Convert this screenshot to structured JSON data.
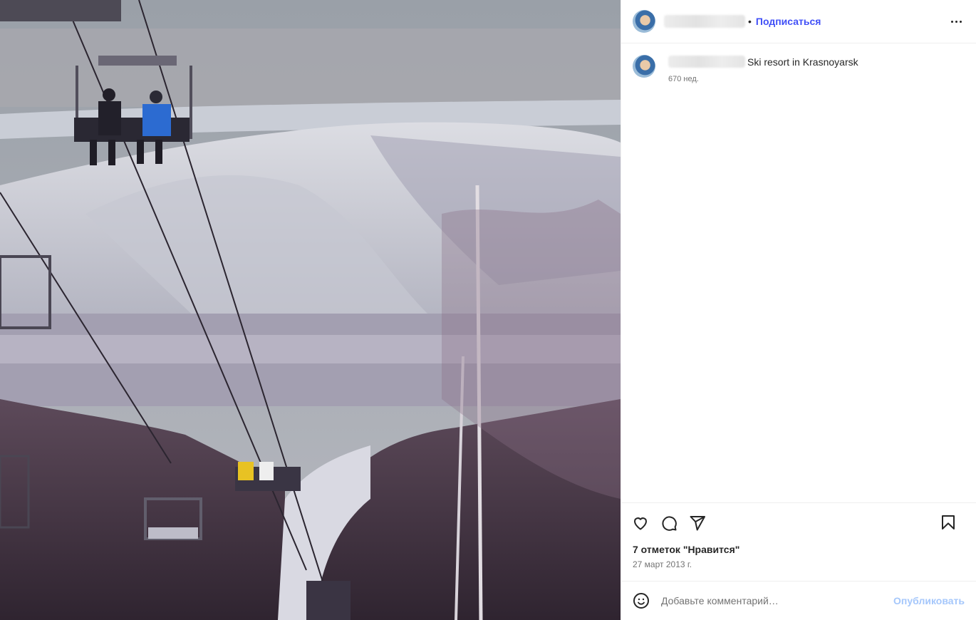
{
  "header": {
    "separator": "•",
    "follow_label": "Подписаться",
    "more_icon": "more-horizontal-icon"
  },
  "caption": {
    "text": "Ski resort in Krasnoyarsk",
    "time_ago": "670 нед."
  },
  "actions": {
    "icons": [
      "heart-icon",
      "comment-icon",
      "share-icon",
      "bookmark-icon"
    ]
  },
  "likes_text": "7 отметок \"Нравится\"",
  "date_text": "27 март 2013 г.",
  "comment": {
    "placeholder": "Добавьте комментарий…",
    "publish_label": "Опубликовать"
  },
  "colors": {
    "accent": "#4150f7",
    "publish_disabled": "#a5c7fb",
    "muted_text": "#737373"
  },
  "photo": {
    "subject": "ski-lift-chairlift-over-snowy-mountain-landscape"
  }
}
